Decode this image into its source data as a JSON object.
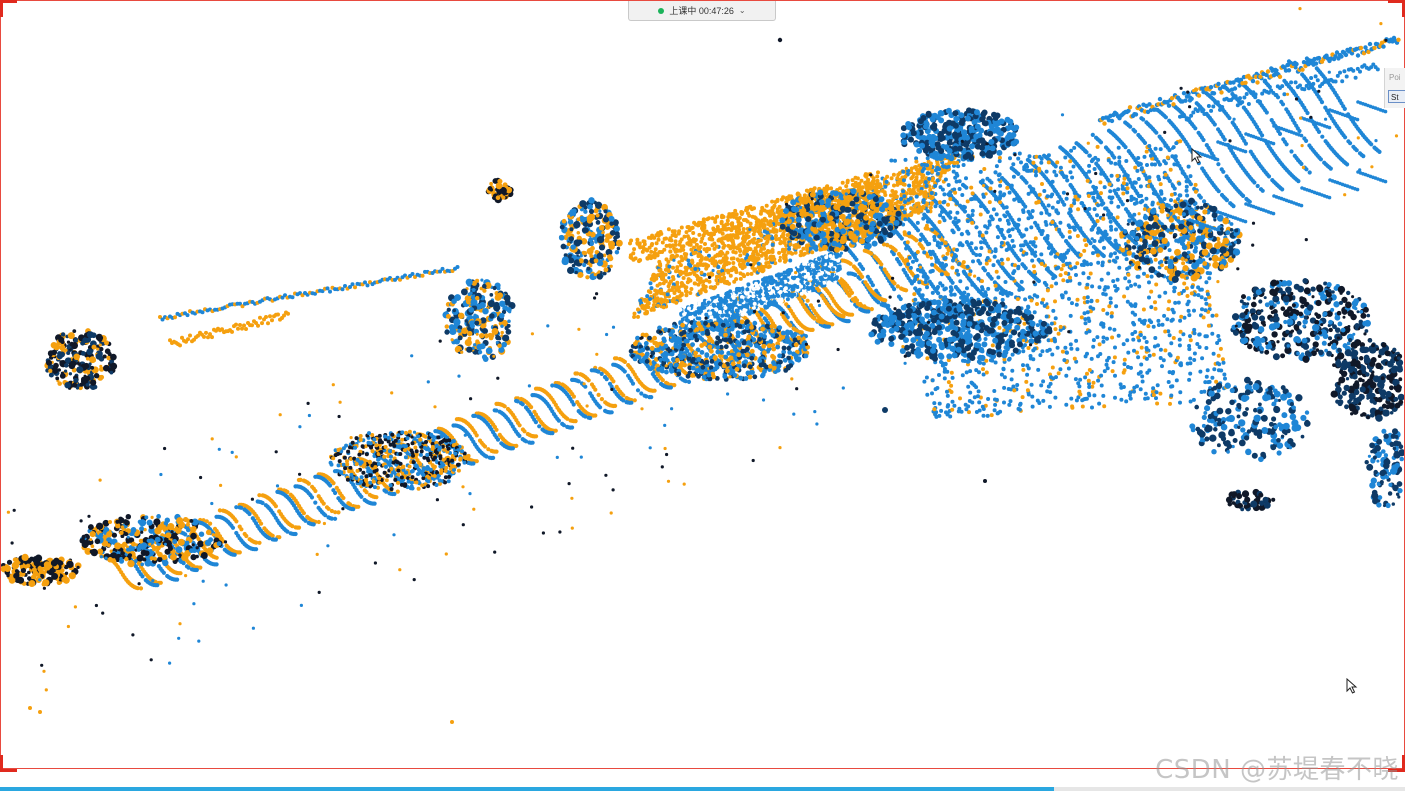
{
  "session": {
    "status_label": "上课中 00:47:26",
    "status_color": "#1bb35a",
    "chevron_icon": "chevron-down-icon"
  },
  "side_panel": {
    "title": "Poi",
    "button_label": "St"
  },
  "viewport": {
    "content": "3D point cloud visualization (two overlaid scans)",
    "scan_colors": {
      "scan_a": "#f5a00f",
      "scan_b": "#1f86d6",
      "shadow": "#0e3a66",
      "dark": "#101828"
    },
    "cursor_icons": [
      "mouse-pointer-icon",
      "mouse-pointer-icon"
    ]
  },
  "progress": {
    "fraction": 0.75,
    "color": "#2aa7e0"
  },
  "watermark": {
    "text": "CSDN @苏堤春不晓"
  },
  "recording_frame_color": "#e84a3f"
}
